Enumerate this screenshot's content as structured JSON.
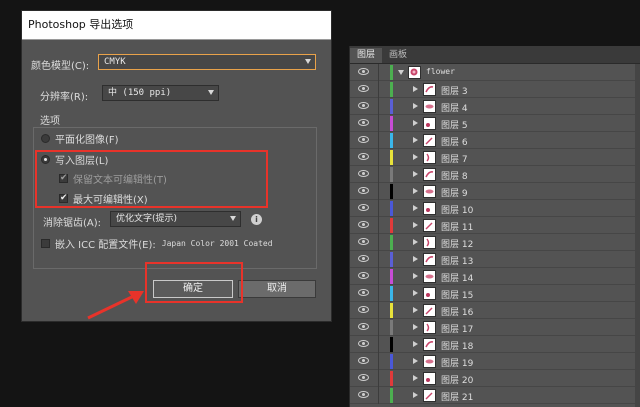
{
  "dialog": {
    "title": "Photoshop 导出选项",
    "color_model_label": "颜色模型(C):",
    "color_model_value": "CMYK",
    "resolution_label": "分辨率(R):",
    "resolution_value": "中 (150 ppi)",
    "options_label": "选项",
    "flatten_label": "平面化图像(F)",
    "write_layers_label": "写入图层(L)",
    "preserve_text_label": "保留文本可编辑性(T)",
    "max_edit_label": "最大可编辑性(X)",
    "antialias_label": "消除锯齿(A):",
    "antialias_value": "优化文字(提示)",
    "icc_label": "嵌入 ICC 配置文件(E):",
    "icc_value": "Japan Color 2001 Coated",
    "ok_label": "确定",
    "cancel_label": "取消",
    "info_glyph": "i"
  },
  "panel": {
    "tabs": [
      "图层",
      "画板"
    ],
    "parent_layer": "flower",
    "layers": [
      {
        "name": "图层 3",
        "color": "#4caf50"
      },
      {
        "name": "图层 4",
        "color": "#5a5fd6"
      },
      {
        "name": "图层 5",
        "color": "#c84cd6"
      },
      {
        "name": "图层 6",
        "color": "#3ab6ea"
      },
      {
        "name": "图层 7",
        "color": "#e8e23a"
      },
      {
        "name": "图层 8",
        "color": "#7a7a7a"
      },
      {
        "name": "图层 9",
        "color": "#000000"
      },
      {
        "name": "图层 10",
        "color": "#4a58d8"
      },
      {
        "name": "图层 11",
        "color": "#e03a3a"
      },
      {
        "name": "图层 12",
        "color": "#4caf50"
      },
      {
        "name": "图层 13",
        "color": "#5a5fd6"
      },
      {
        "name": "图层 14",
        "color": "#c84cd6"
      },
      {
        "name": "图层 15",
        "color": "#3ab6ea"
      },
      {
        "name": "图层 16",
        "color": "#e8e23a"
      },
      {
        "name": "图层 17",
        "color": "#7a7a7a"
      },
      {
        "name": "图层 18",
        "color": "#000000"
      },
      {
        "name": "图层 19",
        "color": "#4a58d8"
      },
      {
        "name": "图层 20",
        "color": "#e03a3a"
      },
      {
        "name": "图层 21",
        "color": "#4caf50"
      }
    ]
  },
  "colors": {
    "annotation_red": "#e8332a",
    "dialog_bg": "#535353",
    "accent_orange": "#e9a24a"
  }
}
